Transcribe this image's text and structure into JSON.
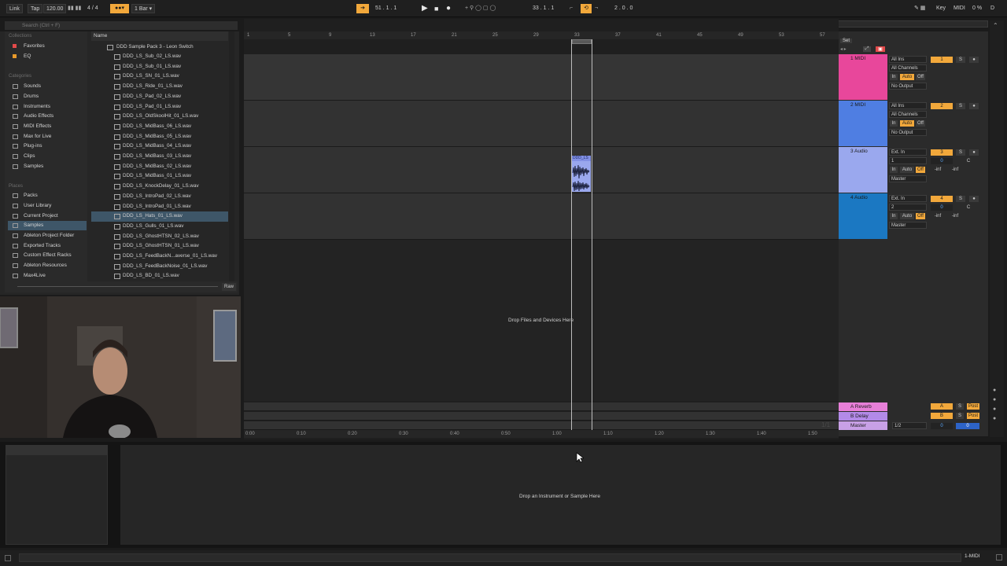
{
  "transport": {
    "link": "Link",
    "tap": "Tap",
    "tempo": "120.00",
    "signature_num": "4",
    "signature_sep": "/",
    "signature_den": "4",
    "quantize": "1 Bar",
    "position": "51 .  1 .  1",
    "loop_start": "33 .  1 .  1",
    "loop_length": "2 .  0 .  0",
    "key": "Key",
    "midi": "MIDI",
    "cpu": "0 %",
    "d": "D"
  },
  "browser": {
    "search_placeholder": "Search (Ctrl + F)",
    "collections_label": "Collections",
    "collections": [
      {
        "label": "Favorites",
        "color": "#e34a4a"
      },
      {
        "label": "EQ",
        "color": "#e89a2b"
      }
    ],
    "categories_label": "Categories",
    "categories": [
      "Sounds",
      "Drums",
      "Instruments",
      "Audio Effects",
      "MIDI Effects",
      "Max for Live",
      "Plug-ins",
      "Clips",
      "Samples"
    ],
    "places_label": "Places",
    "places": [
      "Packs",
      "User Library",
      "Current Project",
      "Samples",
      "Ableton Project Folder",
      "Exported Tracks",
      "Custom Effect Racks",
      "Ableton Resources",
      "Max4Live"
    ],
    "selected_place": "Samples",
    "name_header": "Name",
    "folder": "DDD Sample Pack 3 - Leon Switch",
    "files": [
      "DDD_LS_Sub_02_LS.wav",
      "DDD_LS_Sub_01_LS.wav",
      "DDD_LS_SN_01_LS.wav",
      "DDD_LS_Ride_01_LS.wav",
      "DDD_LS_Pad_02_LS.wav",
      "DDD_LS_Pad_01_LS.wav",
      "DDD_LS_OldSkoolHit_01_LS.wav",
      "DDD_LS_MidBass_06_LS.wav",
      "DDD_LS_MidBass_05_LS.wav",
      "DDD_LS_MidBass_04_LS.wav",
      "DDD_LS_MidBass_03_LS.wav",
      "DDD_LS_MidBass_02_LS.wav",
      "DDD_LS_MidBass_01_LS.wav",
      "DDD_LS_KnockDelay_01_LS.wav",
      "DDD_LS_IntroPad_02_LS.wav",
      "DDD_LS_IntroPad_01_LS.wav",
      "DDD_LS_Hats_01_LS.wav",
      "DDD_LS_Gulls_01_LS.wav",
      "DDD_LS_GhostHTSN_02_LS.wav",
      "DDD_LS_GhostHTSN_01_LS.wav",
      "DDD_LS_FeedBackN...averse_01_LS.wav",
      "DDD_LS_FeedBackNoise_01_LS.wav",
      "DDD_LS_BD_01_LS.wav"
    ],
    "selected_file": "DDD_LS_Hats_01_LS.wav",
    "raw_button": "Raw"
  },
  "ruler": {
    "bars": [
      "1",
      "5",
      "9",
      "13",
      "17",
      "21",
      "25",
      "29",
      "33",
      "37",
      "41",
      "45",
      "49",
      "53",
      "57"
    ],
    "set_label": "Set"
  },
  "time_ruler": [
    "0:00",
    "0:10",
    "0:20",
    "0:30",
    "0:40",
    "0:50",
    "1:00",
    "1:10",
    "1:20",
    "1:30",
    "1:40",
    "1:50"
  ],
  "tracks": [
    {
      "name": "1 MIDI",
      "color": "#e8479b",
      "input": "All Ins",
      "channel": "All Channels",
      "monitor": [
        "In",
        "Auto",
        "Off"
      ],
      "output": "No Output",
      "number": "1"
    },
    {
      "name": "2 MIDI",
      "color": "#4f7ee2",
      "input": "All Ins",
      "channel": "All Channels",
      "monitor": [
        "In",
        "Auto",
        "Off"
      ],
      "output": "No Output",
      "number": "2"
    },
    {
      "name": "3 Audio",
      "color": "#9aa8ee",
      "input": "Ext. In",
      "channel": "1",
      "monitor": [
        "In",
        "Auto",
        "Off"
      ],
      "output": "Master",
      "number": "3",
      "vol": "0",
      "pan": "C",
      "inf1": "-inf",
      "inf2": "-inf"
    },
    {
      "name": "4 Audio",
      "color": "#1b78c2",
      "input": "Ext. In",
      "channel": "2",
      "monitor": [
        "In",
        "Auto",
        "Off"
      ],
      "output": "Master",
      "number": "4",
      "vol": "0",
      "pan": "C",
      "inf1": "-inf",
      "inf2": "-inf"
    }
  ],
  "clip_label": "DDD_LS",
  "returns": [
    {
      "name": "A Reverb",
      "color": "#e77fd8",
      "letter": "A"
    },
    {
      "name": "B Delay",
      "color": "#b38ae8",
      "letter": "B"
    }
  ],
  "master": {
    "name": "Master",
    "color": "#c8a0e6",
    "cue": "1/2",
    "vol": "0",
    "pan": "0"
  },
  "drop_files_text": "Drop Files and Devices Here",
  "page_counter": "1/1",
  "detail_drop_text": "Drop an Instrument or Sample Here",
  "status_track": "1-MIDI",
  "colors": {
    "accent": "#f2a83b",
    "selection": "#3e5668"
  }
}
